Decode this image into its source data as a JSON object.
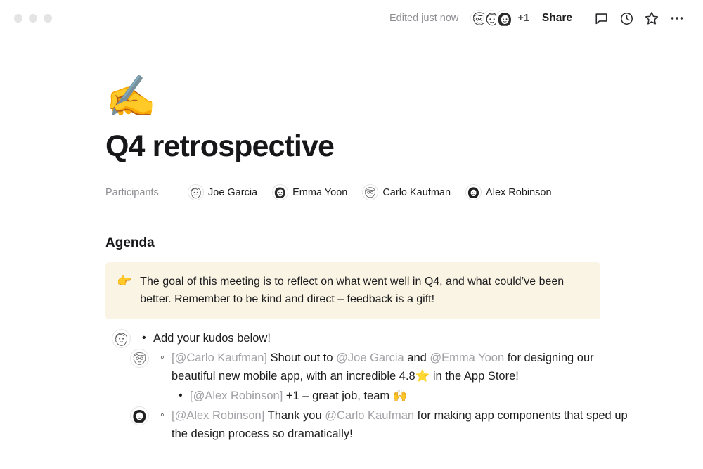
{
  "window": {
    "traffic_lights": [
      "close",
      "minimize",
      "zoom"
    ]
  },
  "header": {
    "edited_status": "Edited just now",
    "collaborators_extra": "+1",
    "share_label": "Share",
    "icons": [
      {
        "name": "comment-icon",
        "label": "Comments"
      },
      {
        "name": "history-clock-icon",
        "label": "Version history"
      },
      {
        "name": "star-icon",
        "label": "Favorite"
      },
      {
        "name": "more-ellipsis-icon",
        "label": "More options"
      }
    ],
    "collaborator_avatars": [
      "curly-hair-face",
      "light-hair-face",
      "dark-hair-face"
    ]
  },
  "document": {
    "cover_emoji": "✍️",
    "cover_emoji_name": "writing-hand-emoji",
    "title": "Q4 retrospective",
    "participants_label": "Participants",
    "participants": [
      {
        "name": "Joe Garcia",
        "avatar": "joe-garcia-avatar"
      },
      {
        "name": "Emma Yoon",
        "avatar": "emma-yoon-avatar"
      },
      {
        "name": "Carlo Kaufman",
        "avatar": "carlo-kaufman-avatar"
      },
      {
        "name": "Alex Robinson",
        "avatar": "alex-robinson-avatar"
      }
    ],
    "agenda_heading": "Agenda",
    "callout": {
      "emoji": "👉",
      "emoji_name": "pointing-right-emoji",
      "text": "The goal of this meeting is to reflect on what went well in Q4, and what could’ve been better. Remember to be kind and direct – feedback is a gift!",
      "background": "#faf4e4"
    },
    "list_items": [
      {
        "level": 1,
        "marker": "•",
        "avatar": "joe-garcia-avatar",
        "has_avatar": true,
        "segments": [
          {
            "type": "text",
            "text": "Add your kudos below!"
          }
        ]
      },
      {
        "level": 2,
        "marker": "◦",
        "avatar": "carlo-kaufman-avatar",
        "has_avatar": true,
        "segments": [
          {
            "type": "mention",
            "text": "[@Carlo Kaufman]"
          },
          {
            "type": "text",
            "text": " Shout out to "
          },
          {
            "type": "mention",
            "text": "@Joe Garcia"
          },
          {
            "type": "text",
            "text": " and "
          },
          {
            "type": "mention",
            "text": "@Emma Yoon"
          },
          {
            "type": "text",
            "text": " for designing our beautiful new mobile app, with an incredible 4.8⭐ in the App Store!"
          }
        ]
      },
      {
        "level": 3,
        "marker": "•",
        "has_avatar": false,
        "segments": [
          {
            "type": "mention",
            "text": "[@Alex Robinson]"
          },
          {
            "type": "text",
            "text": " +1 – great job, team 🙌"
          }
        ]
      },
      {
        "level": 2,
        "marker": "◦",
        "avatar": "alex-robinson-avatar",
        "has_avatar": true,
        "segments": [
          {
            "type": "mention",
            "text": "[@Alex Robinson]"
          },
          {
            "type": "text",
            "text": " Thank you "
          },
          {
            "type": "mention",
            "text": "@Carlo Kaufman"
          },
          {
            "type": "text",
            "text": " for making app components that sped up the design process so dramatically!"
          }
        ]
      }
    ]
  },
  "colors": {
    "text": "#1d1d1f",
    "muted": "#8e8e93",
    "mention": "#a0a0a5",
    "callout_bg": "#faf4e4",
    "divider": "#eeeeee",
    "traffic_dot": "#e4e4e4"
  }
}
